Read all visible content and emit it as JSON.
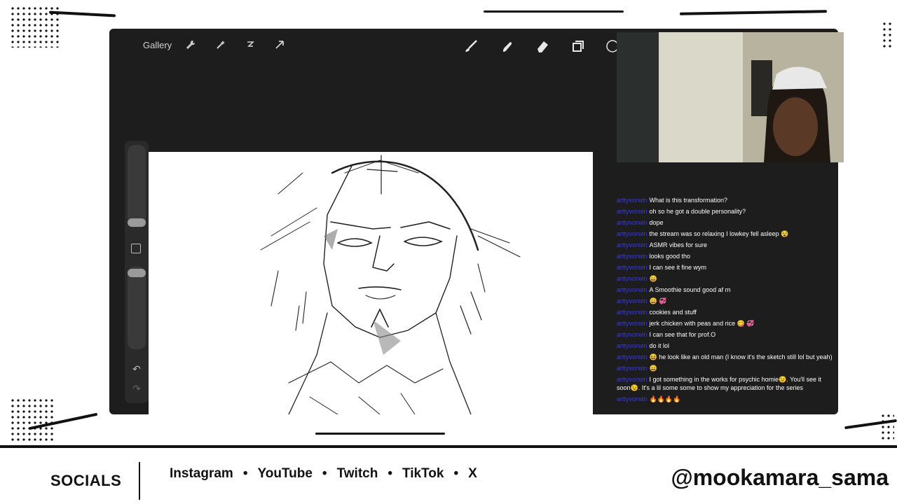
{
  "toolbar": {
    "gallery_label": "Gallery",
    "left_tools": [
      "wrench-icon",
      "magic-wand-icon",
      "selection-icon",
      "transform-icon"
    ],
    "right_tools": [
      "brush-icon",
      "smudge-icon",
      "eraser-icon",
      "layers-icon"
    ]
  },
  "chat": {
    "messages": [
      {
        "user": "arttyvorwin",
        "text": "What is this transformation?"
      },
      {
        "user": "arttyvorwin",
        "text": "oh so he got a double personality?"
      },
      {
        "user": "arttyvorwin",
        "text": "dope"
      },
      {
        "user": "arttyvorwin",
        "text": "the stream was so relaxing I lowkey fell asleep 😵"
      },
      {
        "user": "arttyvorwin",
        "text": "ASMR vibes for sure"
      },
      {
        "user": "arttyvorwin",
        "text": "looks good tho"
      },
      {
        "user": "arttyvorwin",
        "text": "I can see it fine wym"
      },
      {
        "user": "arttyvorwin",
        "text": "😄"
      },
      {
        "user": "arttyvorwin",
        "text": "A Smoothie sound good af rn"
      },
      {
        "user": "arttyvorwin",
        "text": "😄 💞"
      },
      {
        "user": "arttyvorwin",
        "text": "cookies and stuff"
      },
      {
        "user": "arttyvorwin",
        "text": "jerk chicken with peas and rice 😋 💞"
      },
      {
        "user": "arttyvorwin",
        "text": "I can see that for prof.O"
      },
      {
        "user": "arttyvorwin",
        "text": "do it lol"
      },
      {
        "user": "arttyvorwin",
        "text": "😆 he look like an old man (I know it's the sketch still lol but yeah)"
      },
      {
        "user": "arttyvorwin",
        "text": "😄"
      },
      {
        "user": "arttyvorwin",
        "text": "I got something in the works for psychic homie😉. You'll see it soon😉. It's a lil some some to show my appreciation for the series"
      },
      {
        "user": "arttyvorwin",
        "text": "🔥🔥🔥🔥"
      }
    ]
  },
  "footer": {
    "socials_label": "SOCIALS",
    "links": [
      "Instagram",
      "YouTube",
      "Twitch",
      "TikTok",
      "X"
    ],
    "separator": "•",
    "handle": "@mookamara_sama"
  }
}
